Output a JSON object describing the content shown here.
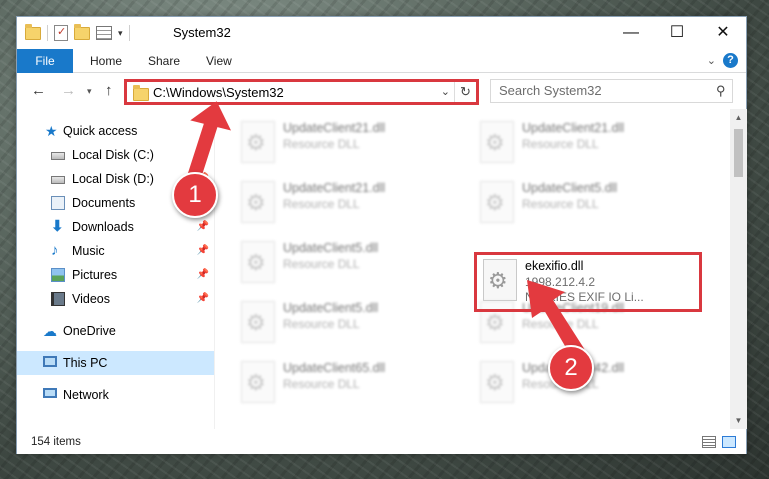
{
  "window": {
    "title": "System32",
    "controls": {
      "minimize": "—",
      "maximize": "☐",
      "close": "✕"
    }
  },
  "ribbon": {
    "tabs": [
      "File",
      "Home",
      "Share",
      "View"
    ],
    "expand_glyph": "⌄",
    "help_glyph": "?"
  },
  "navigation": {
    "back_glyph": "←",
    "forward_glyph": "→",
    "recent_glyph": "▾",
    "up_glyph": "↑",
    "address": "C:\\Windows\\System32",
    "address_dropdown_glyph": "⌄",
    "refresh_glyph": "↻",
    "search_placeholder": "Search System32",
    "search_glyph": "⚲"
  },
  "sidebar": {
    "pin_glyph": "📌",
    "items": [
      {
        "label": "Quick access",
        "icon": "star-icon",
        "pinned": false
      },
      {
        "label": "Local Disk (C:)",
        "icon": "drive-icon",
        "pinned": true
      },
      {
        "label": "Local Disk (D:)",
        "icon": "drive-icon",
        "pinned": true
      },
      {
        "label": "Documents",
        "icon": "documents-icon",
        "pinned": true
      },
      {
        "label": "Downloads",
        "icon": "downloads-icon",
        "pinned": true
      },
      {
        "label": "Music",
        "icon": "music-icon",
        "pinned": true
      },
      {
        "label": "Pictures",
        "icon": "pictures-icon",
        "pinned": true
      },
      {
        "label": "Videos",
        "icon": "videos-icon",
        "pinned": true
      },
      {
        "label": "OneDrive",
        "icon": "cloud-icon",
        "pinned": false
      },
      {
        "label": "This PC",
        "icon": "computer-icon",
        "pinned": false,
        "selected": true
      },
      {
        "label": "Network",
        "icon": "network-icon",
        "pinned": false
      }
    ]
  },
  "files": [
    {
      "name": "UpdateClient21.dll",
      "type": "Resource DLL",
      "blurred": true
    },
    {
      "name": "UpdateClient21.dll",
      "type": "Resource DLL",
      "blurred": true
    },
    {
      "name": "UpdateClient21.dll",
      "type": "Resource DLL",
      "blurred": true
    },
    {
      "name": "UpdateClient5.dll",
      "type": "Resource DLL",
      "blurred": true
    },
    {
      "name": "UpdateClient5.dll",
      "type": "Resource DLL",
      "blurred": true
    },
    {
      "name": "ekexifio.dll",
      "type": "1998.212.4.2",
      "description": "NIF KIES EXIF IO Li...",
      "blurred": false,
      "highlighted": true
    },
    {
      "name": "UpdateClient5.dll",
      "type": "Resource DLL",
      "blurred": true
    },
    {
      "name": "UpdateClient19.dll",
      "type": "Resource DLL",
      "blurred": true
    },
    {
      "name": "UpdateClient65.dll",
      "type": "Resource DLL",
      "blurred": true
    },
    {
      "name": "UpdateClient42.dll",
      "type": "Resource DLL",
      "blurred": true
    }
  ],
  "scrollbar": {
    "up_glyph": "▲",
    "down_glyph": "▼"
  },
  "status": {
    "item_count": "154 items"
  },
  "annotations": {
    "callout_1": "1",
    "callout_2": "2",
    "color": "#e33a3f"
  },
  "colors": {
    "accent": "#1979ca",
    "selection": "#cce8ff",
    "highlight_border": "#d9383f"
  }
}
